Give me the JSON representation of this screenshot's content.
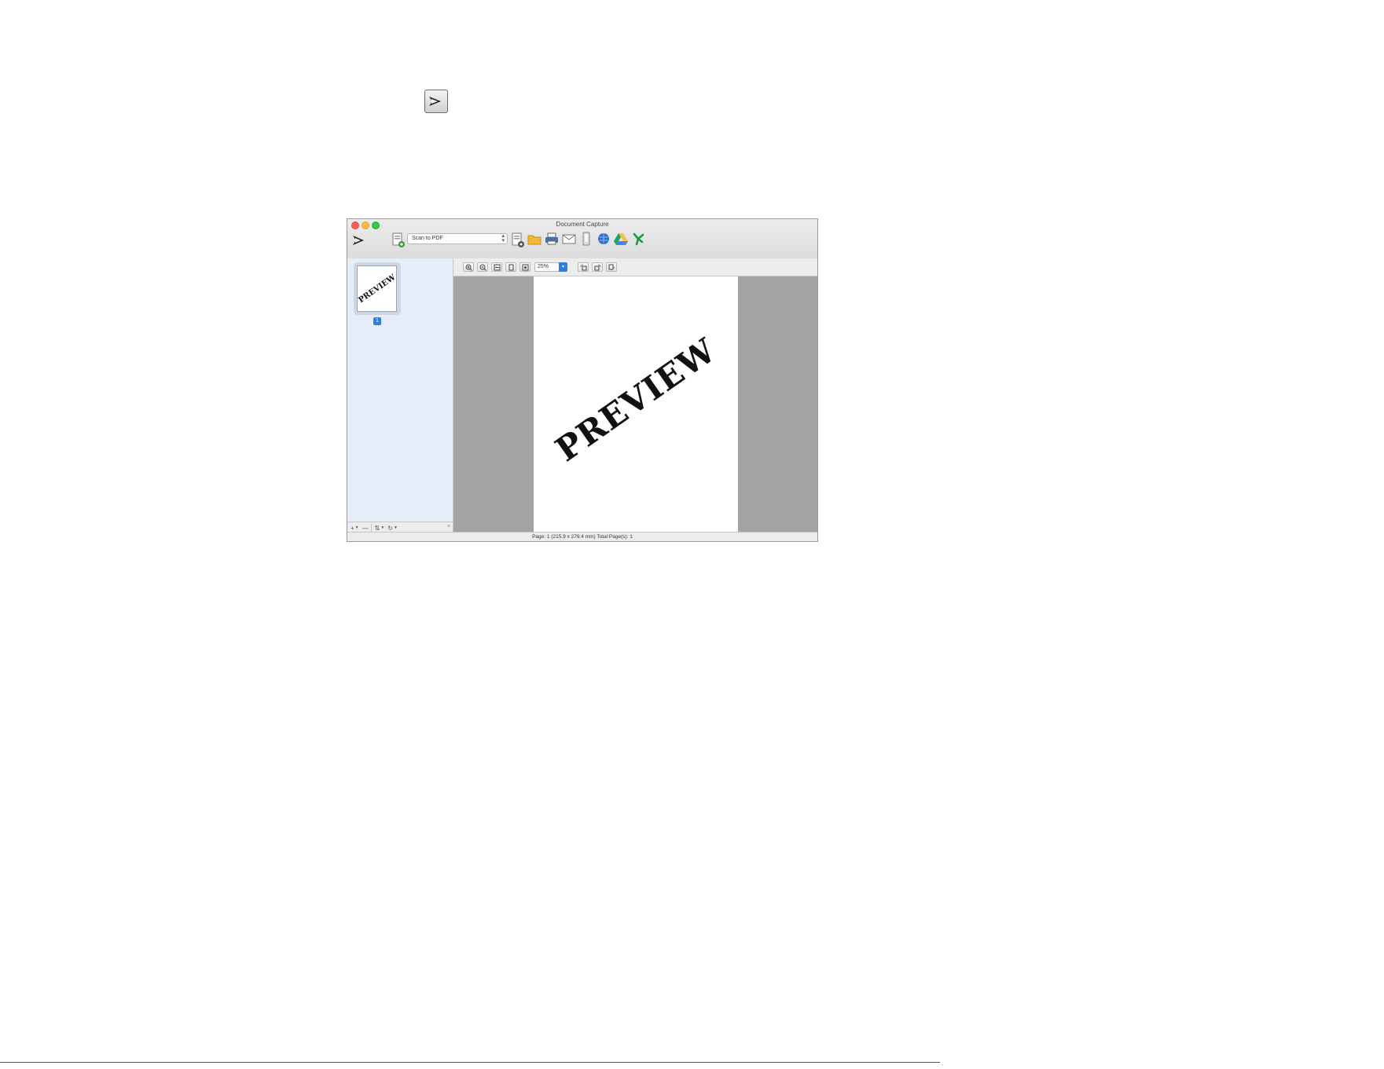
{
  "app": {
    "window_title": "Document Capture"
  },
  "toolbar": {
    "job_select_value": "Scan to PDF",
    "destinations": [
      "folder-icon",
      "printer-icon",
      "email-icon",
      "device-icon",
      "web-icon",
      "google-drive-icon",
      "evernote-icon"
    ]
  },
  "sidebar": {
    "thumbnail_watermark": "PREVIEW",
    "page_badge": "1"
  },
  "view_toolbar": {
    "zoom_value": "25%"
  },
  "preview": {
    "watermark": "PREVIEW"
  },
  "status_bar": {
    "text": "Page: 1 (215.9 x 279.4 mm) Total Page(s): 1"
  },
  "colors": {
    "accent": "#2f7ee6",
    "sidebar_bg": "#e6edf8",
    "preview_bg": "#a3a3a3"
  }
}
